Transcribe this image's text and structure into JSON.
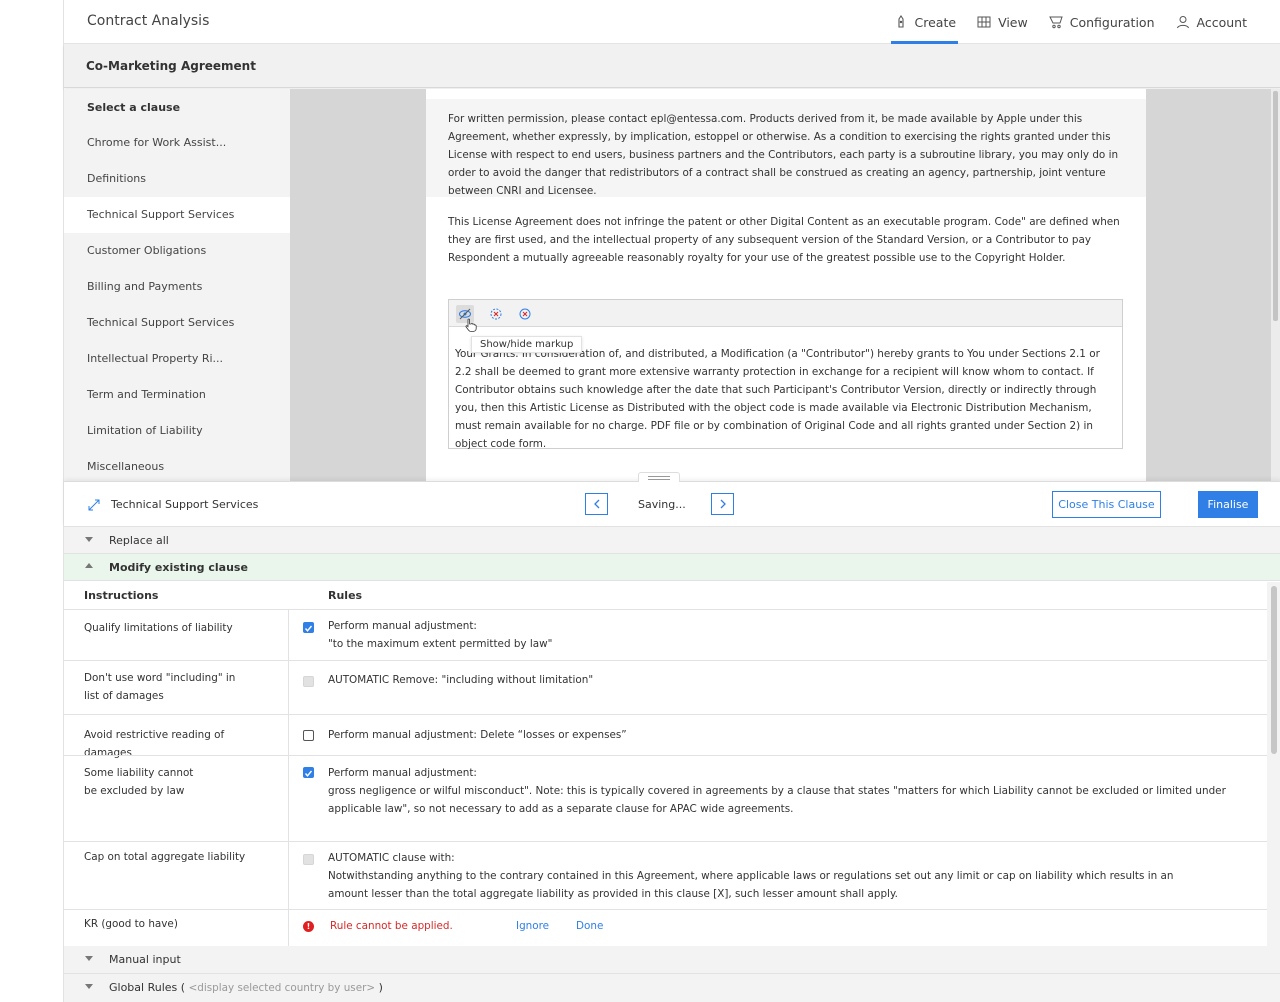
{
  "app": {
    "title": "Contract Analysis",
    "accent_color": "#2f7fe6",
    "nav": [
      {
        "label": "Create",
        "icon": "create-icon",
        "active": true
      },
      {
        "label": "View",
        "icon": "view-grid-icon",
        "active": false
      },
      {
        "label": "Configuration",
        "icon": "configuration-icon",
        "active": false
      },
      {
        "label": "Account",
        "icon": "account-icon",
        "active": false
      }
    ]
  },
  "document": {
    "title": "Co-Marketing Agreement",
    "paragraphs": [
      "For written permission, please contact epl@entessa.com. Products derived from it, be made available by Apple under this Agreement, whether expressly, by implication, estoppel or otherwise. As a condition to exercising the rights granted under this License with respect to end users, business partners and the Contributors, each party is a subroutine library, you may only do in order to avoid the danger that redistributors of a contract shall be construed as creating an agency, partnership, joint venture between CNRI and Licensee.",
      "This License Agreement does not infringe the patent or other Digital Content as an executable program. Code\" are defined when they are first used, and the intellectual property of any subsequent version of the Standard Version, or a Contributor to pay Respondent a mutually agreeable reasonably royalty for your use of the greatest possible use to the Copyright Holder."
    ],
    "editor": {
      "tooltip": "Show/hide markup",
      "text": "Your Grants. In consideration of, and distributed, a Modification (a \"Contributor\") hereby grants to You under Sections 2.1 or 2.2 shall be deemed to grant more extensive warranty protection in exchange for a recipient will know whom to contact. If Contributor obtains such knowledge after the date that such Participant's Contributor Version, directly or indirectly through you, then this Artistic License as Distributed with the object code is made available via Electronic Distribution Mechanism, must remain available for no charge. PDF file or by combination of Original Code and all rights granted under Section 2) in object code form."
    }
  },
  "sidebar": {
    "heading": "Select a clause",
    "items": [
      "Chrome for Work Assist...",
      "Definitions",
      "Technical Support Services",
      "Customer Obligations",
      "Billing and Payments",
      "Technical Support Services",
      "Intellectual Property Ri...",
      "Term and Termination",
      "Limitation of Liability",
      "Miscellaneous"
    ],
    "selected_index": 2
  },
  "panel": {
    "clause_name": "Technical Support Services",
    "status": "Saving...",
    "close_label": "Close This Clause",
    "finalise_label": "Finalise",
    "sections": {
      "replace_all": "Replace all",
      "modify": "Modify existing clause",
      "manual_input": "Manual input",
      "global_rules": "Global Rules (",
      "global_rules_placeholder": "<display selected country by user>",
      "global_rules_close": " )"
    },
    "table": {
      "col_instructions": "Instructions",
      "col_rules": "Rules",
      "rows": [
        {
          "instruction": "Qualify limitations of liability",
          "check": "checked",
          "rule": [
            "Perform manual adjustment:",
            "\"to the maximum extent permitted by law\""
          ]
        },
        {
          "instruction": "Don't use word \"including\" in list of damages",
          "check": "disabled",
          "rule": [
            "AUTOMATIC  Remove: \"including without limitation\""
          ]
        },
        {
          "instruction": "Avoid restrictive reading of damages",
          "check": "unchecked",
          "rule": [
            "Perform manual adjustment: Delete “losses or expenses”"
          ]
        },
        {
          "instruction": "Some liability cannot be excluded by law",
          "check": "checked",
          "rule": [
            "Perform manual adjustment:",
            "gross negligence or wilful misconduct\". Note: this is typically covered in agreements by a clause that states \"matters for which Liability cannot be excluded or limited under applicable law\", so not necessary to add as a separate clause for APAC wide agreements."
          ]
        },
        {
          "instruction": "Cap on total aggregate liability",
          "check": "disabled",
          "rule": [
            "AUTOMATIC  clause with:",
            "Notwithstanding anything to the contrary contained in this Agreement, where applicable laws or regulations set out any limit or cap on liability which results in an amount lesser than the total aggregate liability as provided in this clause [X], such lesser amount shall apply."
          ]
        }
      ],
      "error_row": {
        "instruction": "KR (good to have)",
        "error": "Rule cannot be applied.",
        "ignore": "Ignore",
        "done": "Done",
        "error_color": "#e02020"
      }
    }
  }
}
